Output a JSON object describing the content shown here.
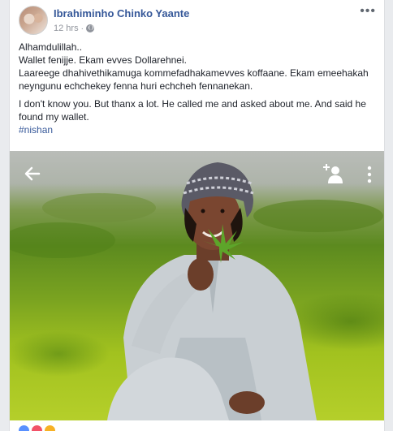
{
  "post": {
    "author": "Ibrahiminho Chinko Yaante",
    "timestamp": "12 hrs",
    "separator": "·",
    "privacy_icon": "globe-icon",
    "more_icon": "ellipsis-icon",
    "more_label": "•••",
    "lines": [
      "Alhamdulillah..",
      "Wallet fenijje. Ekam evves Dollarehnei.",
      "Laareege dhahivethikamuga kommefadhakamevves koffaane. Ekam emeehakah neyngunu echchekey fenna huri echcheh fennanekan."
    ],
    "line2": "I don't know you. But thanx a lot. He called me and asked about me. And said he found my wallet.",
    "hashtag": "#nishan"
  },
  "photo": {
    "back_icon": "arrow-left-icon",
    "tag_icon": "add-person-icon",
    "menu_icon": "vertical-dots-icon"
  },
  "reactions": {
    "icons": [
      "like-icon",
      "love-icon",
      "haha-icon"
    ],
    "colors": [
      "#5890ff",
      "#f25268",
      "#f7b125"
    ]
  },
  "colors": {
    "link": "#365899",
    "text": "#1d2129",
    "meta": "#90949c",
    "background": "#e9ebee"
  }
}
